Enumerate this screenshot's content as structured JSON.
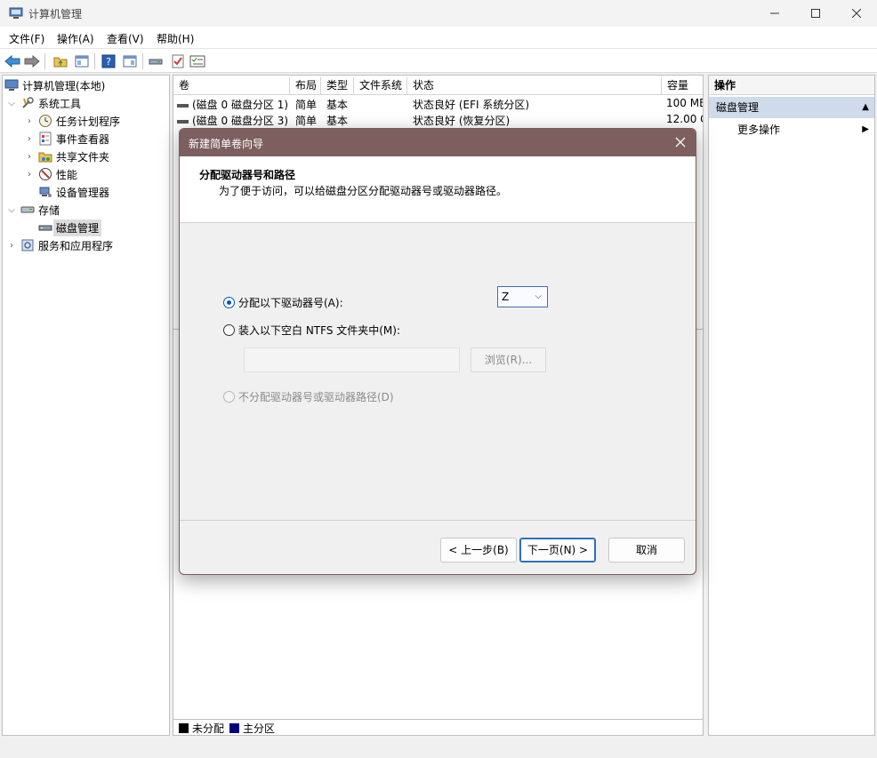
{
  "window": {
    "title": "计算机管理"
  },
  "menu": [
    "文件(F)",
    "操作(A)",
    "查看(V)",
    "帮助(H)"
  ],
  "tree": {
    "root": "计算机管理(本地)",
    "system_tools": "系统工具",
    "task_scheduler": "任务计划程序",
    "event_viewer": "事件查看器",
    "shared_folders": "共享文件夹",
    "performance": "性能",
    "device_manager": "设备管理器",
    "storage": "存储",
    "disk_management": "磁盘管理",
    "services": "服务和应用程序"
  },
  "volume_list": {
    "columns": [
      "卷",
      "布局",
      "类型",
      "文件系统",
      "状态",
      "容量"
    ],
    "rows": [
      {
        "volume": "(磁盘 0 磁盘分区 1)",
        "layout": "简单",
        "type": "基本",
        "fs": "",
        "status": "状态良好 (EFI 系统分区)",
        "capacity": "100 ME"
      },
      {
        "volume": "(磁盘 0 磁盘分区 3)",
        "layout": "简单",
        "type": "基本",
        "fs": "",
        "status": "状态良好 (恢复分区)",
        "capacity": "12.00 G"
      }
    ],
    "legend": {
      "unallocated": "未分配",
      "primary": "主分区"
    }
  },
  "actions": {
    "header": "操作",
    "section": "磁盘管理",
    "more": "更多操作"
  },
  "dialog": {
    "title": "新建简单卷向导",
    "heading": "分配驱动器号和路径",
    "subheading": "为了便于访问，可以给磁盘分区分配驱动器号或驱动器路径。",
    "option_assign": "分配以下驱动器号(A):",
    "option_mount": "装入以下空白 NTFS 文件夹中(M):",
    "option_none": "不分配驱动器号或驱动器路径(D)",
    "drive_letter": "Z",
    "browse": "浏览(R)...",
    "back": "< 上一步(B)",
    "next": "下一页(N) >",
    "cancel": "取消"
  },
  "colors": {
    "dialog_title_bar": "#7d5f5f",
    "actions_section": "#cfdaea",
    "unallocated_swatch": "#000000",
    "primary_swatch": "#000080",
    "accent": "#0057b8"
  }
}
